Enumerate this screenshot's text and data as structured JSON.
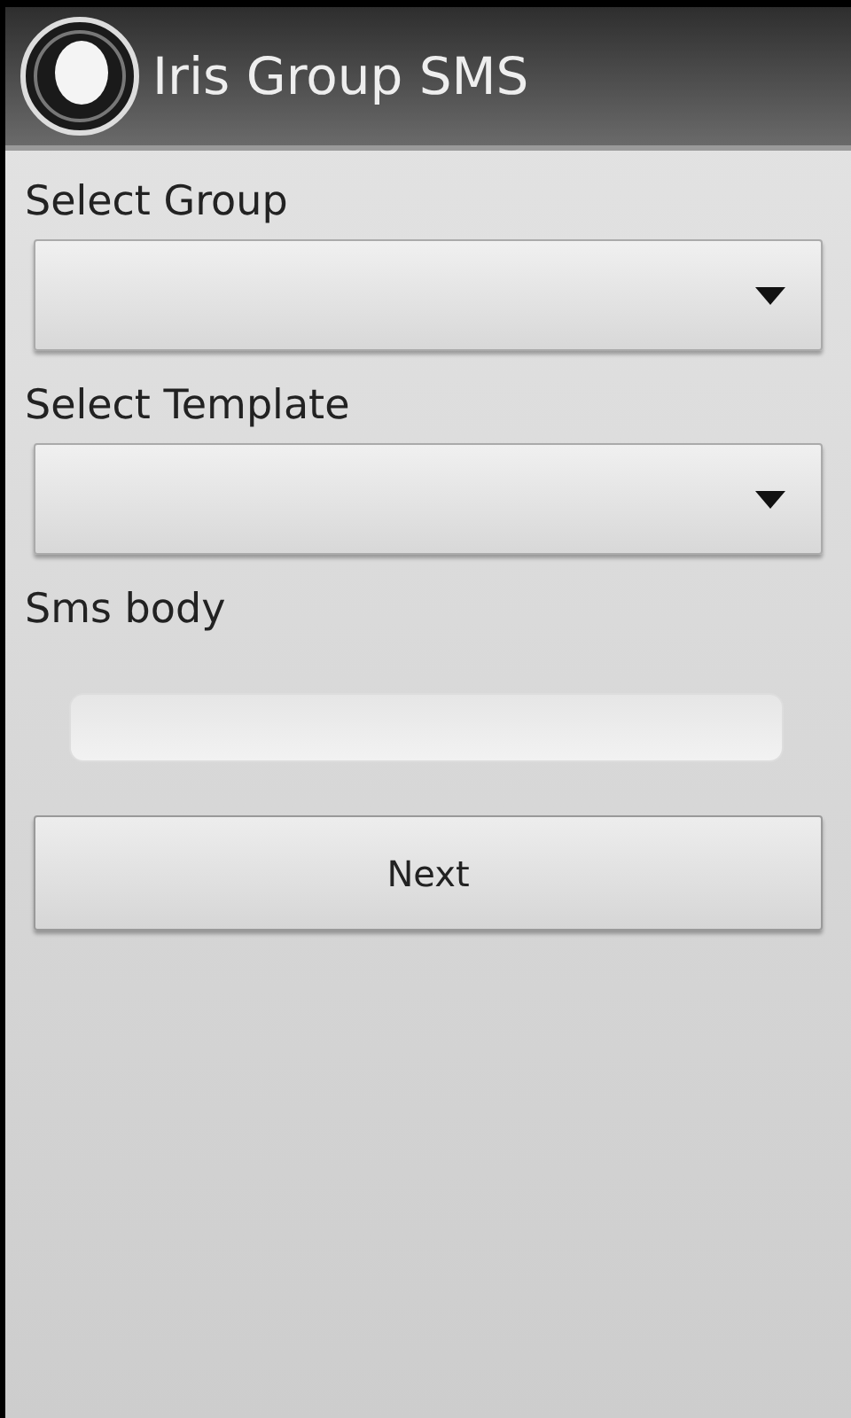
{
  "app_bar": {
    "title": "Iris Group SMS"
  },
  "fields": [
    {
      "label": "Select Group",
      "kind": "dropdown"
    },
    {
      "label": "Select Template",
      "kind": "dropdown"
    },
    {
      "label": "Sms body",
      "kind": "text"
    }
  ],
  "button": {
    "label": "Next"
  }
}
